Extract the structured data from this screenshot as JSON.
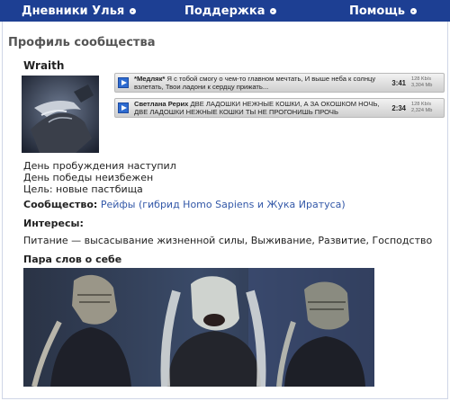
{
  "nav": {
    "items": [
      {
        "label": "Дневники Улья"
      },
      {
        "label": "Поддержка"
      },
      {
        "label": "Помощь"
      }
    ]
  },
  "profile": {
    "title": "Профиль сообщества",
    "name": "Wraith"
  },
  "tracks": [
    {
      "artist": "*Медляк*",
      "text": "Я с тобой смогу о чем-то главном мечтать, И выше неба к солнцу взлетать, Твои ладони к сердцу прижать...",
      "duration": "3:41",
      "bitrate": "128 Kb/s",
      "size": "3,304 Mb"
    },
    {
      "artist": "Светлана Рерих",
      "text": "ДВЕ ЛАДОШКИ НЕЖНЫЕ КОШКИ, А ЗА ОКОШКОМ НОЧЬ, ДВЕ ЛАДОШКИ НЕЖНЫЕ КОШКИ ТЫ НЕ ПРОГОНИШЬ ПРОЧЬ",
      "duration": "2:34",
      "bitrate": "128 Kb/s",
      "size": "2,324 Mb"
    }
  ],
  "bio": {
    "line1": "День пробуждения наступил",
    "line2": "День победы неизбежен",
    "line3": "Цель: новые пастбища"
  },
  "community": {
    "label": "Сообщество:",
    "value": "Рейфы (гибрид Homo Sapiens и Жука Иратуса)"
  },
  "interests": {
    "heading": "Интересы:",
    "text": "Питание — высасывание жизненной силы, Выживание, Развитие, Господство"
  },
  "about": {
    "heading": "Пара слов о себе"
  },
  "colors": {
    "nav_bg": "#1d3f93",
    "link": "#3358a8"
  },
  "icons": {
    "nav_dropdown": "chevron-down-icon",
    "track_play": "play-icon"
  }
}
